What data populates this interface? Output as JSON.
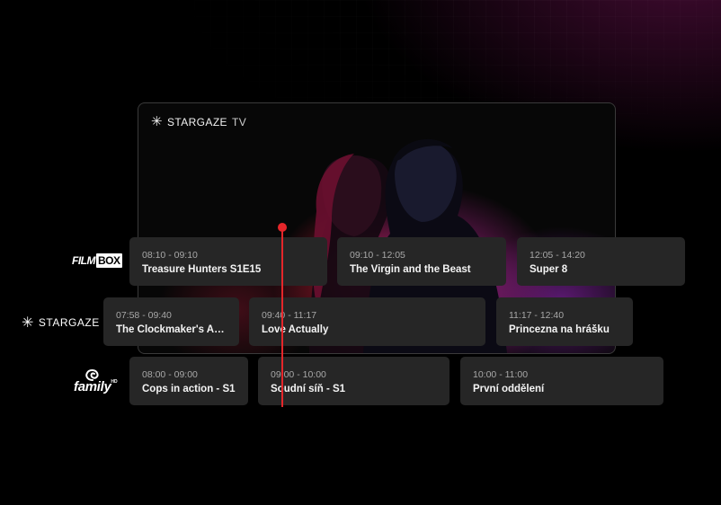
{
  "colors": {
    "accent": "#e5262a",
    "card_bg": "#262626",
    "bg": "#000000"
  },
  "tv": {
    "brand": "STARGAZE",
    "brand_suffix": "TV",
    "icon": "star-burst-icon"
  },
  "channels": [
    {
      "logo_icon": "filmbox-logo",
      "logo_parts": [
        "FILM",
        "BOX"
      ],
      "programs": [
        {
          "time": "08:10 - 09:10",
          "title": "Treasure Hunters S1E15"
        },
        {
          "time": "09:10 - 12:05",
          "title": "The Virgin and the Beast"
        },
        {
          "time": "12:05 - 14:20",
          "title": "Super 8"
        }
      ]
    },
    {
      "logo_icon": "stargaze-logo",
      "logo_text": "STARGAZE",
      "programs": [
        {
          "time": "07:58 - 09:40",
          "title": "The Clockmaker's Ap..."
        },
        {
          "time": "09:40 - 11:17",
          "title": "Love Actually"
        },
        {
          "time": "11:17 - 12:40",
          "title": "Princezna na hrášku"
        }
      ]
    },
    {
      "logo_icon": "family-hd-logo",
      "logo_text": "family",
      "logo_badge": "HD",
      "programs": [
        {
          "time": "08:00 - 09:00",
          "title": "Cops in action - S1"
        },
        {
          "time": "09:00 - 10:00",
          "title": "Soudní síň - S1"
        },
        {
          "time": "10:00 - 11:00",
          "title": "První oddělení"
        }
      ]
    }
  ]
}
